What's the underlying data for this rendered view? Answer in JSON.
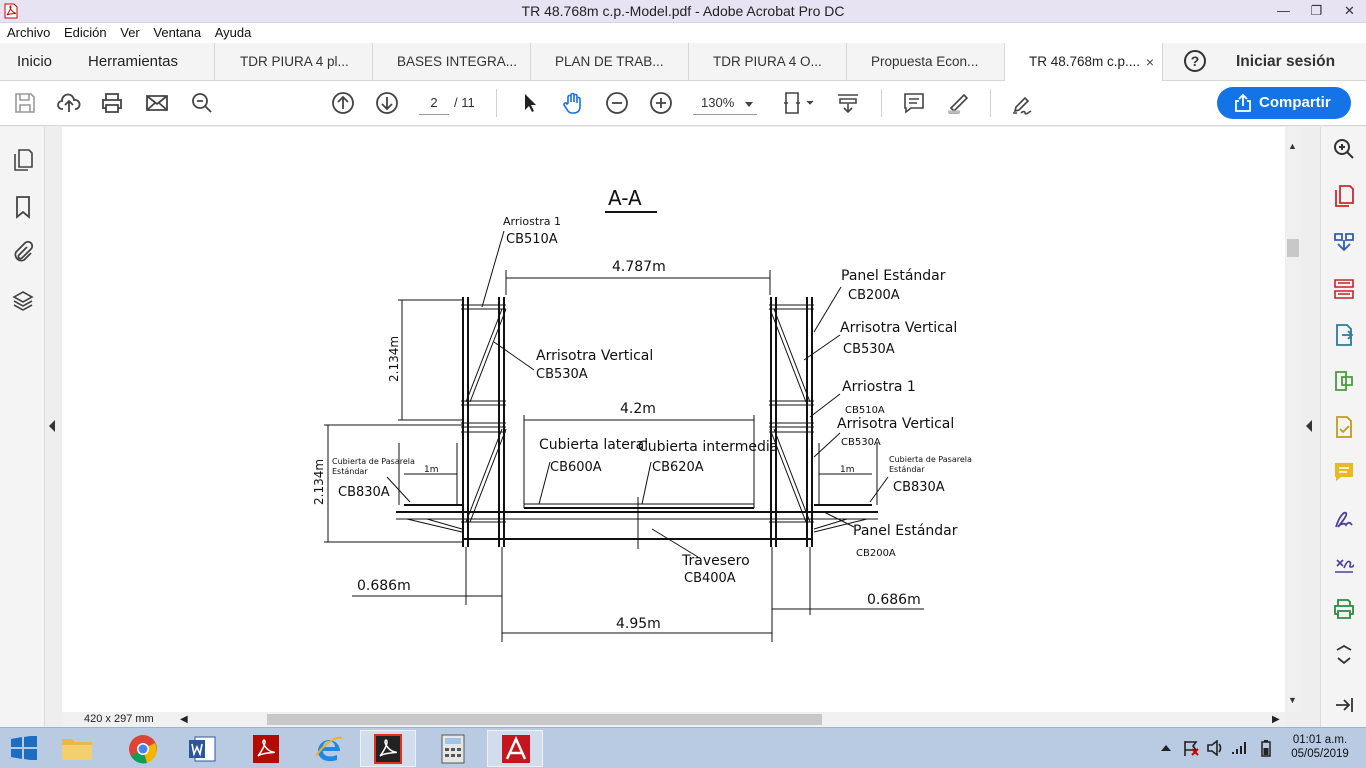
{
  "window": {
    "title": "TR 48.768m c.p.-Model.pdf - Adobe Acrobat Pro DC",
    "minimize": "—",
    "restore": "❐",
    "close": "✕"
  },
  "menu": [
    "Archivo",
    "Edición",
    "Ver",
    "Ventana",
    "Ayuda"
  ],
  "tabs": {
    "home": "Inicio",
    "tools": "Herramientas",
    "docs": [
      "TDR PIURA 4 pl...",
      "BASES INTEGRA...",
      "PLAN DE TRAB...",
      "TDR PIURA 4 O...",
      "Propuesta Econ..."
    ],
    "active": "TR 48.768m c.p....",
    "active_close": "×"
  },
  "help": "?",
  "signin": "Iniciar sesión",
  "toolbar": {
    "page_current": "2",
    "page_total": "/ 11",
    "zoom": "130%"
  },
  "share": "Compartir",
  "drawing": {
    "section_title": "A-A",
    "labels": {
      "arriostra1_top": "Arriostra 1",
      "cb510a_top": "CB510A",
      "dim_4787": "4.787m",
      "panel_estandar_top": "Panel Estándar",
      "cb200a_top": "CB200A",
      "arrisotra_vertical_r1": "Arrisotra Vertical",
      "cb530a_r1": "CB530A",
      "arrisotra_vertical_l": "Arrisotra Vertical",
      "cb530a_l": "CB530A",
      "dim_2134_top": "2.134m",
      "arriostra1_r": "Arriostra 1",
      "cb510a_r": "CB510A",
      "dim_42": "4.2m",
      "arrisotra_vertical_r2": "Arrisotra Vertical",
      "cb530a_r2": "CB530A",
      "cubierta_pasarela_l1": "Cubierta de Pasarela",
      "cubierta_pasarela_l2": "Estándar",
      "cb830a_l": "CB830A",
      "dim_1m_l": "1m",
      "cubierta_lateral": "Cubierta lateral",
      "cb600a": "CB600A",
      "cubierta_intermedia": "Cubierta intermedia",
      "cb620a": "CB620A",
      "dim_1m_r": "1m",
      "cubierta_pasarela_r1": "Cubierta de Pasarela",
      "cubierta_pasarela_r2": "Estándar",
      "cb830a_r": "CB830A",
      "dim_2134_bottom": "2.134m",
      "panel_estandar_bottom": "Panel Estándar",
      "cb200a_bottom": "CB200A",
      "travesero": "Travesero",
      "cb400a": "CB400A",
      "dim_0686_l": "0.686m",
      "dim_0686_r": "0.686m",
      "dim_495": "4.95m"
    }
  },
  "page_size": "420 x 297 mm",
  "clock": {
    "time": "01:01 a.m.",
    "date": "05/05/2019"
  }
}
